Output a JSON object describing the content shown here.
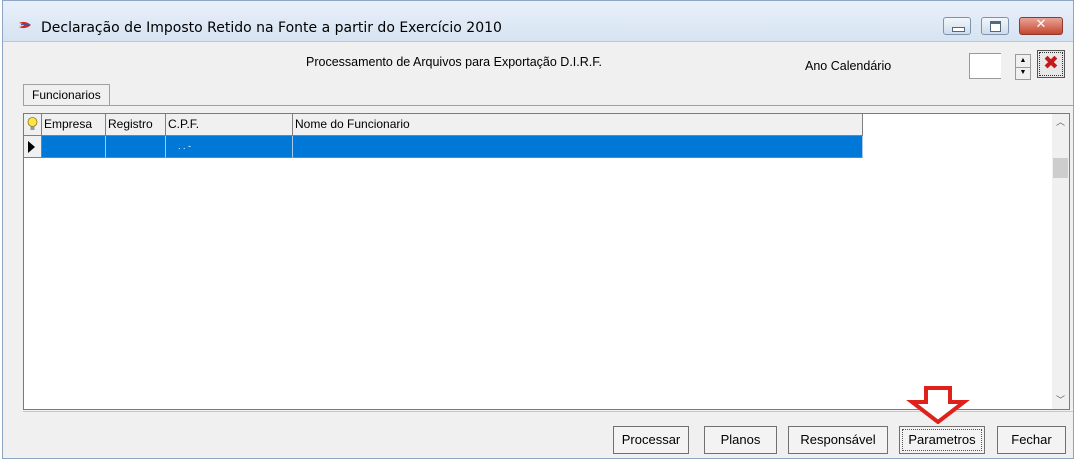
{
  "window": {
    "title": "Declaração de Imposto Retido na Fonte a partir do Exercício 2010",
    "close_glyph": "✕"
  },
  "header": {
    "title": "Processamento de Arquivos para Exportação D.I.R.F.",
    "ano_label": "Ano Calendário",
    "ano_value": "",
    "clear_glyph": "✖"
  },
  "tabs": [
    {
      "label": "Funcionarios",
      "selected": true
    }
  ],
  "grid": {
    "columns": [
      "Empresa",
      "Registro",
      "C.P.F.",
      "Nome do Funcionario"
    ],
    "rows": [
      {
        "empresa": "",
        "registro": "",
        "cpf": ". . -",
        "nome": "",
        "selected": true
      }
    ]
  },
  "buttons": {
    "processar": "Processar",
    "planos": "Planos",
    "responsavel": "Responsável",
    "parametros": "Parametros",
    "fechar": "Fechar"
  },
  "icons": {
    "app": "app-swoosh-icon",
    "bulb": "lightbulb-icon",
    "row_indicator": "row-pointer-icon",
    "annotation": "red-down-arrow"
  },
  "colors": {
    "selection": "#0078d7",
    "close_button": "#c4452f",
    "annotation_arrow": "#e0201b"
  }
}
